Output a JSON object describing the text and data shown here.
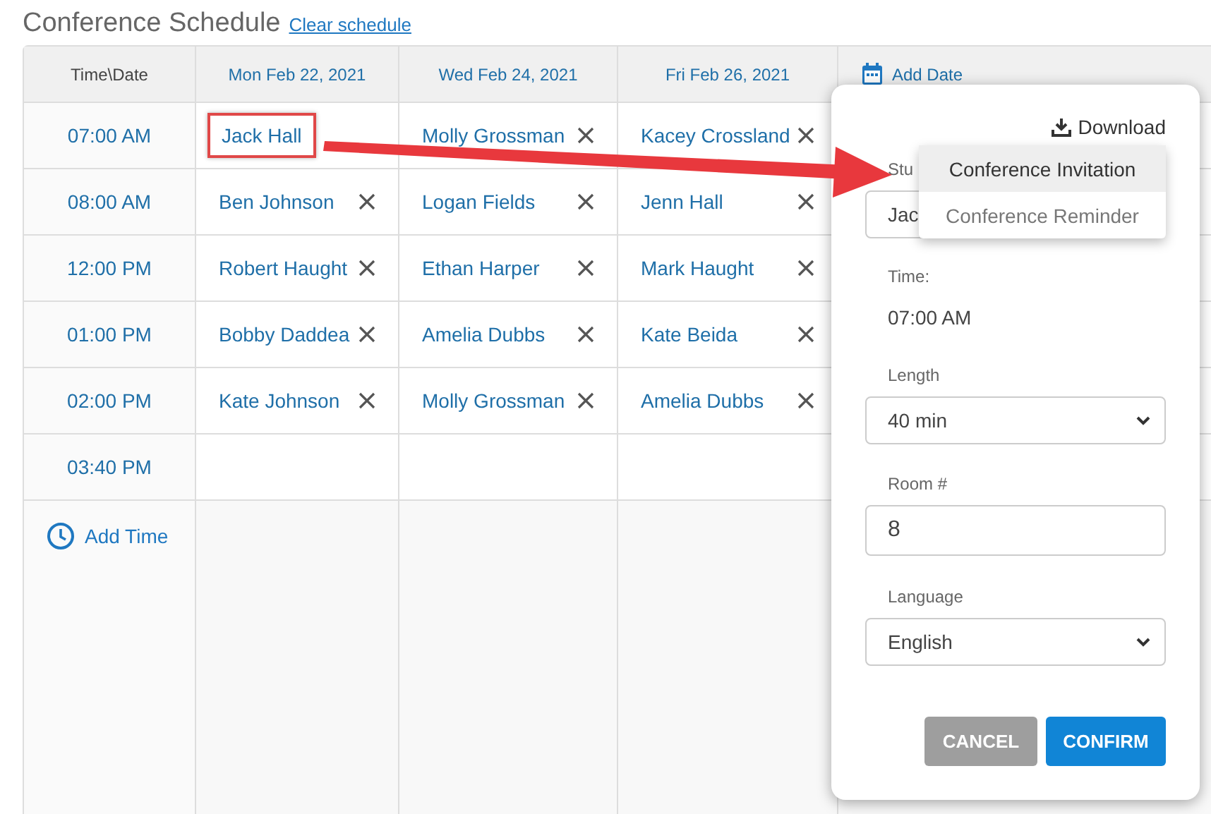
{
  "page": {
    "title": "Conference Schedule",
    "clear_link": "Clear schedule"
  },
  "schedule": {
    "corner_header": "Time\\Date",
    "dates": [
      "Mon Feb 22, 2021",
      "Wed Feb 24, 2021",
      "Fri Feb 26, 2021"
    ],
    "add_date": "Add Date",
    "rows": [
      {
        "time": "07:00 AM",
        "cells": [
          {
            "name": "Jack Hall",
            "removable": false,
            "highlighted": true
          },
          {
            "name": "Molly Grossman",
            "removable": true,
            "highlighted": false
          },
          {
            "name": "Kacey Crossland",
            "removable": true,
            "highlighted": false
          }
        ]
      },
      {
        "time": "08:00 AM",
        "cells": [
          {
            "name": "Ben Johnson",
            "removable": true,
            "highlighted": false
          },
          {
            "name": "Logan Fields",
            "removable": true,
            "highlighted": false
          },
          {
            "name": "Jenn Hall",
            "removable": true,
            "highlighted": false
          }
        ]
      },
      {
        "time": "12:00 PM",
        "cells": [
          {
            "name": "Robert Haught",
            "removable": true,
            "highlighted": false
          },
          {
            "name": "Ethan Harper",
            "removable": true,
            "highlighted": false
          },
          {
            "name": "Mark Haught",
            "removable": true,
            "highlighted": false
          }
        ]
      },
      {
        "time": "01:00 PM",
        "cells": [
          {
            "name": "Bobby Daddea",
            "removable": true,
            "highlighted": false
          },
          {
            "name": "Amelia Dubbs",
            "removable": true,
            "highlighted": false
          },
          {
            "name": "Kate Beida",
            "removable": true,
            "highlighted": false
          }
        ]
      },
      {
        "time": "02:00 PM",
        "cells": [
          {
            "name": "Kate Johnson",
            "removable": true,
            "highlighted": false
          },
          {
            "name": "Molly Grossman",
            "removable": true,
            "highlighted": false
          },
          {
            "name": "Amelia Dubbs",
            "removable": true,
            "highlighted": false
          }
        ]
      },
      {
        "time": "03:40 PM"
      }
    ],
    "add_time": "Add Time"
  },
  "popup": {
    "download": "Download",
    "download_menu": [
      {
        "label": "Conference Invitation",
        "selected": true
      },
      {
        "label": "Conference Reminder",
        "selected": false
      }
    ],
    "student": {
      "label": "Stu",
      "value": "Jac"
    },
    "time": {
      "label": "Time:",
      "value": "07:00 AM"
    },
    "length": {
      "label": "Length",
      "value": "40 min"
    },
    "room": {
      "label": "Room #",
      "value": "8"
    },
    "language": {
      "label": "Language",
      "value": "English"
    },
    "buttons": [
      {
        "label": "CANCEL",
        "kind": "secondary"
      },
      {
        "label": "CONFIRM",
        "kind": "primary"
      }
    ]
  }
}
